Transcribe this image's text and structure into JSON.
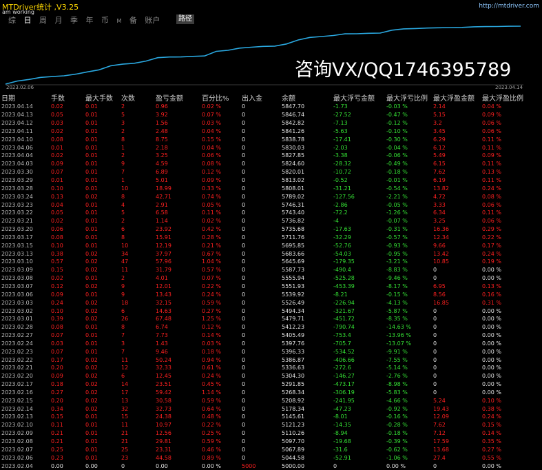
{
  "app": {
    "title": "MTDriver统计 ,V3.25",
    "url": "http://mtdriver.com",
    "status": "am working"
  },
  "tabs": [
    "综",
    "日",
    "周",
    "月",
    "季",
    "年",
    "币",
    "M",
    "备",
    "账户"
  ],
  "active_tab": "日",
  "path_button": "路径",
  "watermark": "咨询VX/QQ1746395789",
  "chart": {
    "start_label": "2023.02.06",
    "end_label": "2023.04.14",
    "line_color": "#2aa8e0",
    "y_range": [
      5000,
      5847.7
    ]
  },
  "columns": [
    "日期",
    "手数",
    "最大手数",
    "次数",
    "盈亏金额",
    "百分比%",
    "出入金",
    "余额",
    "最大浮亏金额",
    "最大浮亏比例",
    "最大浮盈金额",
    "最大浮盈比例"
  ],
  "rows": [
    [
      "2023.04.14",
      "0.02",
      "0.01",
      "2",
      "0.96",
      "0.02 %",
      "0",
      "5847.70",
      "-1.73",
      "-0.03 %",
      "2.14",
      "0.04 %"
    ],
    [
      "2023.04.13",
      "0.05",
      "0.01",
      "5",
      "3.92",
      "0.07 %",
      "0",
      "5846.74",
      "-27.52",
      "-0.47 %",
      "5.15",
      "0.09 %"
    ],
    [
      "2023.04.12",
      "0.03",
      "0.01",
      "3",
      "1.56",
      "0.03 %",
      "0",
      "5842.82",
      "-7.13",
      "-0.12 %",
      "3.2",
      "0.06 %"
    ],
    [
      "2023.04.11",
      "0.02",
      "0.01",
      "2",
      "2.48",
      "0.04 %",
      "0",
      "5841.26",
      "-5.63",
      "-0.10 %",
      "3.45",
      "0.06 %"
    ],
    [
      "2023.04.10",
      "0.08",
      "0.01",
      "8",
      "8.75",
      "0.15 %",
      "0",
      "5838.78",
      "-17.41",
      "-0.30 %",
      "6.29",
      "0.11 %"
    ],
    [
      "2023.04.06",
      "0.01",
      "0.01",
      "1",
      "2.18",
      "0.04 %",
      "0",
      "5830.03",
      "-2.03",
      "-0.04 %",
      "6.12",
      "0.11 %"
    ],
    [
      "2023.04.04",
      "0.02",
      "0.01",
      "2",
      "3.25",
      "0.06 %",
      "0",
      "5827.85",
      "-3.38",
      "-0.06 %",
      "5.49",
      "0.09 %"
    ],
    [
      "2023.04.03",
      "0.09",
      "0.01",
      "9",
      "4.59",
      "0.08 %",
      "0",
      "5824.60",
      "-28.32",
      "-0.49 %",
      "6.15",
      "0.11 %"
    ],
    [
      "2023.03.30",
      "0.07",
      "0.01",
      "7",
      "6.89",
      "0.12 %",
      "0",
      "5820.01",
      "-10.72",
      "-0.18 %",
      "7.62",
      "0.13 %"
    ],
    [
      "2023.03.29",
      "0.01",
      "0.01",
      "1",
      "5.01",
      "0.09 %",
      "0",
      "5813.02",
      "-0.52",
      "-0.01 %",
      "6.19",
      "0.11 %"
    ],
    [
      "2023.03.28",
      "0.10",
      "0.01",
      "10",
      "18.99",
      "0.33 %",
      "0",
      "5808.01",
      "-31.21",
      "-0.54 %",
      "13.82",
      "0.24 %"
    ],
    [
      "2023.03.24",
      "0.13",
      "0.02",
      "8",
      "42.71",
      "0.74 %",
      "0",
      "5789.02",
      "-127.56",
      "-2.21 %",
      "4.72",
      "0.08 %"
    ],
    [
      "2023.03.23",
      "0.04",
      "0.01",
      "4",
      "2.91",
      "0.05 %",
      "0",
      "5746.31",
      "-2.86",
      "-0.05 %",
      "3.33",
      "0.06 %"
    ],
    [
      "2023.03.22",
      "0.05",
      "0.01",
      "5",
      "6.58",
      "0.11 %",
      "0",
      "5743.40",
      "-72.2",
      "-1.26 %",
      "6.34",
      "0.11 %"
    ],
    [
      "2023.03.21",
      "0.02",
      "0.01",
      "2",
      "1.14",
      "0.02 %",
      "0",
      "5736.82",
      "-4",
      "-0.07 %",
      "3.25",
      "0.06 %"
    ],
    [
      "2023.03.20",
      "0.06",
      "0.01",
      "6",
      "23.92",
      "0.42 %",
      "0",
      "5735.68",
      "-17.63",
      "-0.31 %",
      "16.36",
      "0.29 %"
    ],
    [
      "2023.03.17",
      "0.08",
      "0.01",
      "8",
      "15.91",
      "0.28 %",
      "0",
      "5711.76",
      "-32.29",
      "-0.57 %",
      "12.34",
      "0.22 %"
    ],
    [
      "2023.03.15",
      "0.10",
      "0.01",
      "10",
      "12.19",
      "0.21 %",
      "0",
      "5695.85",
      "-52.76",
      "-0.93 %",
      "9.66",
      "0.17 %"
    ],
    [
      "2023.03.13",
      "0.38",
      "0.02",
      "34",
      "37.97",
      "0.67 %",
      "0",
      "5683.66",
      "-54.03",
      "-0.95 %",
      "13.42",
      "0.24 %"
    ],
    [
      "2023.03.10",
      "0.57",
      "0.02",
      "47",
      "57.96",
      "1.04 %",
      "0",
      "5645.69",
      "-179.35",
      "-3.21 %",
      "10.85",
      "0.19 %"
    ],
    [
      "2023.03.09",
      "0.15",
      "0.02",
      "11",
      "31.79",
      "0.57 %",
      "0",
      "5587.73",
      "-490.4",
      "-8.83 %",
      "0",
      "0.00 %"
    ],
    [
      "2023.03.08",
      "0.02",
      "0.01",
      "2",
      "4.01",
      "0.07 %",
      "0",
      "5555.94",
      "-525.28",
      "-9.46 %",
      "0",
      "0.00 %"
    ],
    [
      "2023.03.07",
      "0.12",
      "0.02",
      "9",
      "12.01",
      "0.22 %",
      "0",
      "5551.93",
      "-453.39",
      "-8.17 %",
      "6.95",
      "0.13 %"
    ],
    [
      "2023.03.06",
      "0.09",
      "0.01",
      "9",
      "13.43",
      "0.24 %",
      "0",
      "5539.92",
      "-8.21",
      "-0.15 %",
      "8.56",
      "0.16 %"
    ],
    [
      "2023.03.03",
      "0.24",
      "0.02",
      "18",
      "32.15",
      "0.59 %",
      "0",
      "5526.49",
      "-226.94",
      "-4.13 %",
      "16.85",
      "0.31 %"
    ],
    [
      "2023.03.02",
      "0.10",
      "0.02",
      "6",
      "14.63",
      "0.27 %",
      "0",
      "5494.34",
      "-321.67",
      "-5.87 %",
      "0",
      "0.00 %"
    ],
    [
      "2023.03.01",
      "0.39",
      "0.02",
      "26",
      "67.48",
      "1.25 %",
      "0",
      "5479.71",
      "-451.72",
      "-8.35 %",
      "0",
      "0.00 %"
    ],
    [
      "2023.02.28",
      "0.08",
      "0.01",
      "8",
      "6.74",
      "0.12 %",
      "0",
      "5412.23",
      "-790.74",
      "-14.63 %",
      "0",
      "0.00 %"
    ],
    [
      "2023.02.27",
      "0.07",
      "0.01",
      "7",
      "7.73",
      "0.14 %",
      "0",
      "5405.49",
      "-753.4",
      "-13.96 %",
      "0",
      "0.00 %"
    ],
    [
      "2023.02.24",
      "0.03",
      "0.01",
      "3",
      "1.43",
      "0.03 %",
      "0",
      "5397.76",
      "-705.7",
      "-13.07 %",
      "0",
      "0.00 %"
    ],
    [
      "2023.02.23",
      "0.07",
      "0.01",
      "7",
      "9.46",
      "0.18 %",
      "0",
      "5396.33",
      "-534.52",
      "-9.91 %",
      "0",
      "0.00 %"
    ],
    [
      "2023.02.22",
      "0.17",
      "0.02",
      "11",
      "50.24",
      "0.94 %",
      "0",
      "5386.87",
      "-406.66",
      "-7.55 %",
      "0",
      "0.00 %"
    ],
    [
      "2023.02.21",
      "0.20",
      "0.02",
      "12",
      "32.33",
      "0.61 %",
      "0",
      "5336.63",
      "-272.6",
      "-5.14 %",
      "0",
      "0.00 %"
    ],
    [
      "2023.02.20",
      "0.09",
      "0.02",
      "6",
      "12.45",
      "0.24 %",
      "0",
      "5304.30",
      "-146.27",
      "-2.76 %",
      "0",
      "0.00 %"
    ],
    [
      "2023.02.17",
      "0.18",
      "0.02",
      "14",
      "23.51",
      "0.45 %",
      "0",
      "5291.85",
      "-473.17",
      "-8.98 %",
      "0",
      "0.00 %"
    ],
    [
      "2023.02.16",
      "0.27",
      "0.02",
      "17",
      "59.42",
      "1.14 %",
      "0",
      "5268.34",
      "-306.19",
      "-5.83 %",
      "0",
      "0.00 %"
    ],
    [
      "2023.02.15",
      "0.20",
      "0.02",
      "13",
      "30.58",
      "0.59 %",
      "0",
      "5208.92",
      "-241.95",
      "-4.66 %",
      "5.24",
      "0.10 %"
    ],
    [
      "2023.02.14",
      "0.34",
      "0.02",
      "32",
      "32.73",
      "0.64 %",
      "0",
      "5178.34",
      "-47.23",
      "-0.92 %",
      "19.43",
      "0.38 %"
    ],
    [
      "2023.02.13",
      "0.15",
      "0.01",
      "15",
      "24.38",
      "0.48 %",
      "0",
      "5145.61",
      "-8.01",
      "-0.16 %",
      "12.09",
      "0.24 %"
    ],
    [
      "2023.02.10",
      "0.11",
      "0.01",
      "11",
      "10.97",
      "0.22 %",
      "0",
      "5121.23",
      "-14.35",
      "-0.28 %",
      "7.62",
      "0.15 %"
    ],
    [
      "2023.02.09",
      "0.21",
      "0.01",
      "21",
      "12.56",
      "0.25 %",
      "0",
      "5110.26",
      "-8.94",
      "-0.18 %",
      "7.12",
      "0.14 %"
    ],
    [
      "2023.02.08",
      "0.21",
      "0.01",
      "21",
      "29.81",
      "0.59 %",
      "0",
      "5097.70",
      "-19.68",
      "-0.39 %",
      "17.59",
      "0.35 %"
    ],
    [
      "2023.02.07",
      "0.25",
      "0.01",
      "25",
      "23.31",
      "0.46 %",
      "0",
      "5067.89",
      "-31.6",
      "-0.62 %",
      "13.68",
      "0.27 %"
    ],
    [
      "2023.02.06",
      "0.23",
      "0.01",
      "23",
      "44.58",
      "0.89 %",
      "0",
      "5044.58",
      "-52.91",
      "-1.06 %",
      "27.4",
      "0.55 %"
    ],
    [
      "2023.02.04",
      "0.00",
      "0.00",
      "0",
      "0.00",
      "0.00 %",
      "5000",
      "5000.00",
      "0",
      "0.00 %",
      "0",
      "0.00 %"
    ]
  ]
}
